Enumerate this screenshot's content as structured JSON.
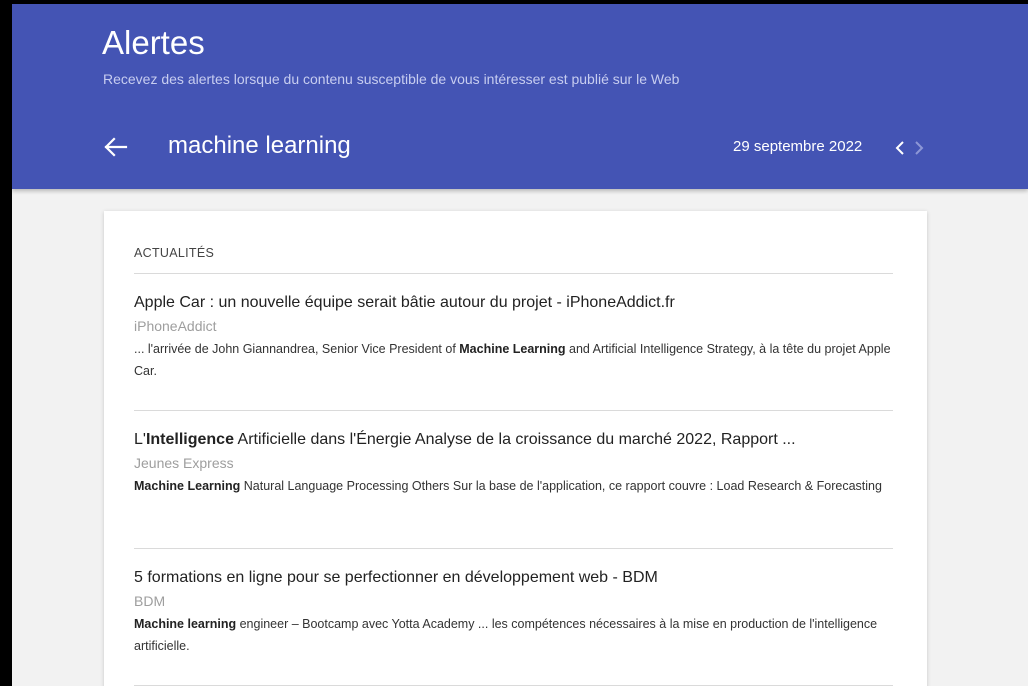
{
  "header": {
    "title": "Alertes",
    "subtitle": "Recevez des alertes lorsque du contenu susceptible de vous intéresser est publié sur le Web",
    "query": "machine learning",
    "date": "29 septembre 2022"
  },
  "icons": {
    "back": "arrow-left-icon",
    "prev": "chevron-left-icon",
    "next": "chevron-right-icon"
  },
  "colors": {
    "header_bg": "#4454b4",
    "page_bg": "#f2f2f2",
    "source_text": "#9e9e9e"
  },
  "section": {
    "label": "ACTUALITÉS"
  },
  "articles": [
    {
      "title": "Apple Car : un nouvelle équipe serait bâtie autour du projet - iPhoneAddict.fr",
      "source": "iPhoneAddict",
      "snippet": [
        {
          "text": "... l'arrivée de John Giannandrea, Senior Vice President of ",
          "bold": false
        },
        {
          "text": "Machine Learning",
          "bold": true
        },
        {
          "text": " and Artificial Intelligence Strategy, à la tête du projet Apple Car.",
          "bold": false
        }
      ]
    },
    {
      "title_parts": [
        {
          "text": "L'",
          "bold": false
        },
        {
          "text": "Intelligence",
          "bold": true
        },
        {
          "text": " Artificielle dans l'Énergie Analyse de la croissance du marché 2022, Rapport ...",
          "bold": false
        }
      ],
      "source": "Jeunes Express",
      "snippet": [
        {
          "text": "Machine Learning",
          "bold": true
        },
        {
          "text": " Natural Language Processing Others Sur la base de l'application, ce rapport couvre : Load Research & Forecasting",
          "bold": false
        }
      ]
    },
    {
      "title": "5 formations en ligne pour se perfectionner en développement web - BDM",
      "source": "BDM",
      "snippet": [
        {
          "text": "Machine learning",
          "bold": true
        },
        {
          "text": " engineer – Bootcamp avec Yotta Academy ... les compétences nécessaires à la mise en production de l'intelligence artificielle.",
          "bold": false
        }
      ]
    }
  ]
}
